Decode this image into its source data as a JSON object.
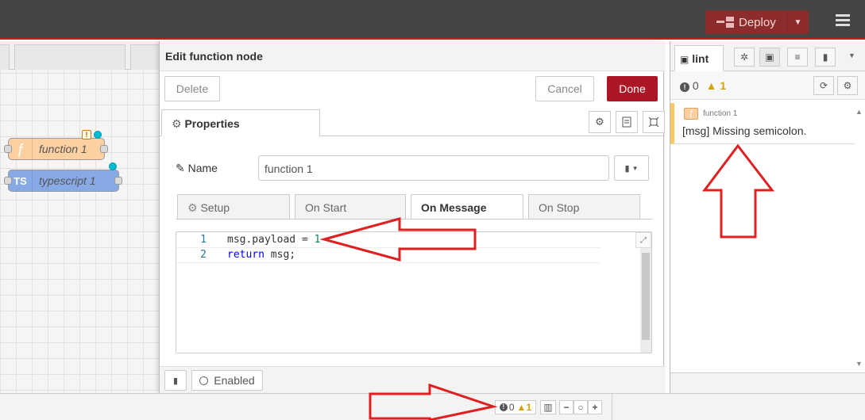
{
  "header": {
    "deploy_label": "Deploy"
  },
  "workspace": {
    "nodes": [
      {
        "label": "function 1",
        "icon_text": "ƒ",
        "color": "#fdd0a2"
      },
      {
        "label": "typescript 1",
        "icon_text": "TS",
        "color": "#87a9e6"
      }
    ],
    "badge_text": "!"
  },
  "editor": {
    "title": "Edit function node",
    "delete_label": "Delete",
    "cancel_label": "Cancel",
    "done_label": "Done",
    "properties_tab": "Properties",
    "name_label": "Name",
    "name_value": "function 1",
    "subtabs": [
      "Setup",
      "On Start",
      "On Message",
      "On Stop"
    ],
    "code_lines": [
      {
        "n": "1",
        "text_a": "msg.payload = ",
        "num": "1"
      },
      {
        "n": "2",
        "kw": "return",
        "text_b": " msg;"
      }
    ],
    "enabled_label": "Enabled"
  },
  "sidebar": {
    "tab_label": "lint",
    "errors": "0",
    "warnings": "1",
    "item_node": "function 1",
    "item_message": "[msg] Missing semicolon."
  },
  "statusbar": {
    "errors": "0",
    "warnings": "1"
  },
  "colors": {
    "accent": "#ad1625",
    "header": "#444444",
    "deploy": "#8c2c2c",
    "annotation": "#e02020"
  }
}
